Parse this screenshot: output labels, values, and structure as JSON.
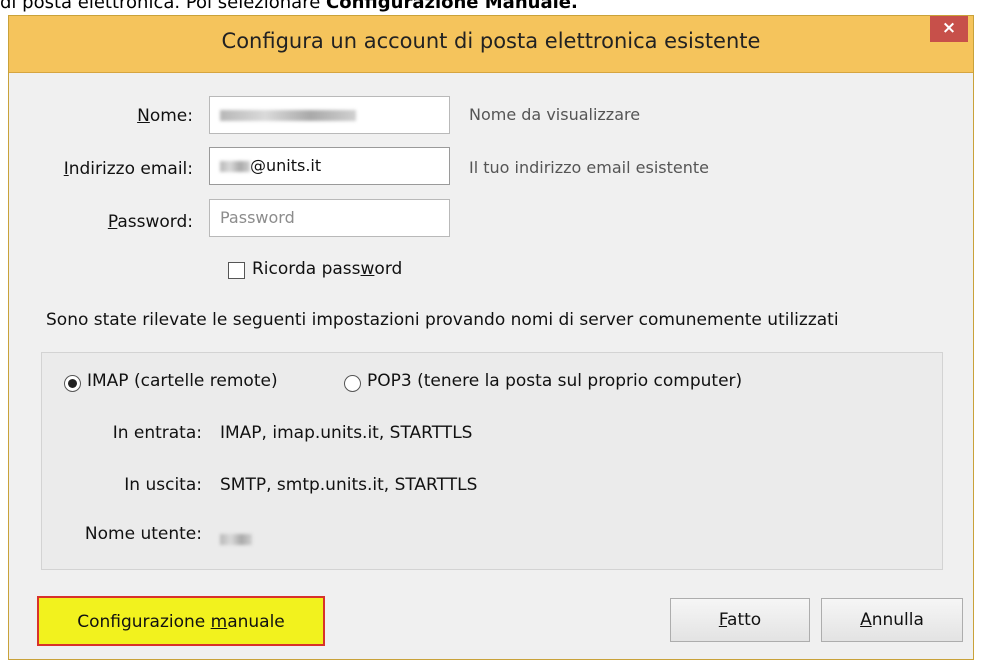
{
  "caption": {
    "prefix": "di posta elettronica. Poi selezionare ",
    "bold": "Configurazione Manuale."
  },
  "dialog": {
    "title": "Configura un account di posta elettronica esistente",
    "close_glyph": "×"
  },
  "form": {
    "name": {
      "label_accel": "N",
      "label_rest": "ome:",
      "hint": "Nome da visualizzare"
    },
    "email": {
      "label_accel": "I",
      "label_rest": "ndirizzo email:",
      "value_suffix": "@units.it",
      "hint": "Il tuo indirizzo email esistente"
    },
    "password": {
      "label_accel": "P",
      "label_rest": "assword:",
      "placeholder": "Password"
    },
    "remember": {
      "label_pre": "Ricorda pass",
      "label_accel": "w",
      "label_post": "ord",
      "checked": false
    }
  },
  "detected_message": "Sono state rilevate le seguenti impostazioni provando nomi di server comunemente utilizzati",
  "settings": {
    "protocol_imap": "IMAP (cartelle remote)",
    "protocol_pop3": "POP3 (tenere la posta sul proprio computer)",
    "selected_protocol": "IMAP",
    "incoming_label": "In entrata:",
    "incoming_value": "IMAP, imap.units.it, STARTTLS",
    "outgoing_label": "In uscita:",
    "outgoing_value": "SMTP, smtp.units.it, STARTTLS",
    "username_label": "Nome utente:"
  },
  "buttons": {
    "manual_pre": "Configurazione ",
    "manual_accel": "m",
    "manual_post": "anuale",
    "done_accel": "F",
    "done_post": "atto",
    "cancel_accel": "A",
    "cancel_post": "nnulla"
  },
  "colors": {
    "titlebar": "#f5c45c",
    "close_button": "#c7504a",
    "highlight": "#f2f21e",
    "highlight_border": "#d8322a"
  },
  "icons": {
    "close": "close-icon",
    "checkbox": "checkbox-icon",
    "radio": "radio-icon"
  }
}
